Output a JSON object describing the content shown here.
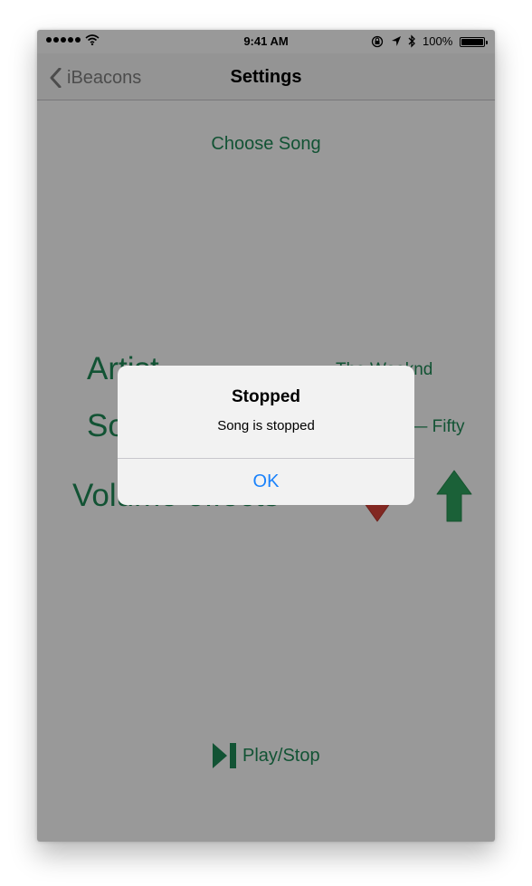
{
  "status_bar": {
    "time": "9:41 AM",
    "battery_text": "100%",
    "signal_dots": 5,
    "icons": [
      "signal-dots-icon",
      "wifi-icon",
      "orientation-lock-icon",
      "location-arrow-icon",
      "bluetooth-icon",
      "battery-icon"
    ]
  },
  "nav": {
    "back_label": "iBeacons",
    "title": "Settings",
    "back_icon": "chevron-left-icon"
  },
  "content": {
    "choose_song": "Choose Song",
    "artist_label": "Artist",
    "artist_value": "The Weeknd",
    "song_label": "Song",
    "song_value": "Earned It — Fifty Shades",
    "volume_label": "Volume effects",
    "volume_down_icon": "arrow-down-icon",
    "volume_up_icon": "arrow-up-icon",
    "play_stop_label": "Play/Stop",
    "play_stop_icon": "play-pause-icon"
  },
  "alert": {
    "title": "Stopped",
    "message": "Song is stopped",
    "ok_label": "OK"
  },
  "colors": {
    "accent_green": "#1f8a57",
    "volume_down_red": "#d9443a",
    "alert_button_blue": "#1a82fb",
    "dim_overlay": "rgba(0,0,0,0.4)"
  }
}
